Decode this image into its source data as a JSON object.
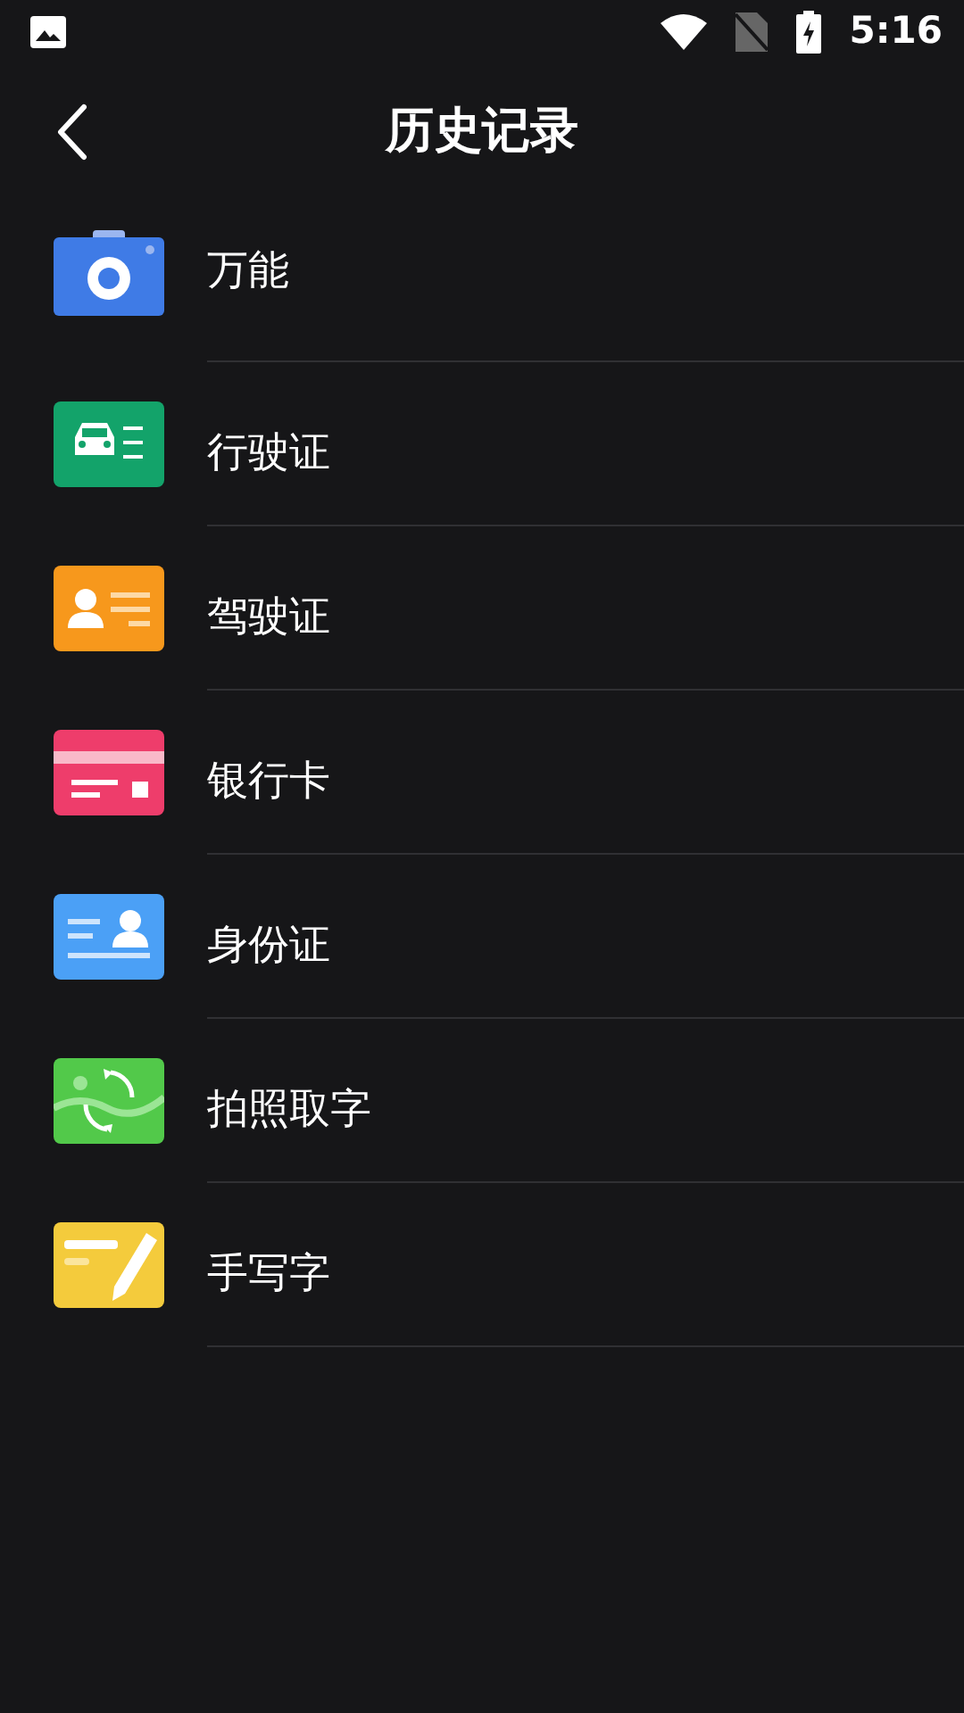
{
  "status_bar": {
    "time": "5:16"
  },
  "header": {
    "title": "历史记录"
  },
  "items": [
    {
      "kind": "camera",
      "label": "万能"
    },
    {
      "kind": "vehicle",
      "label": "行驶证"
    },
    {
      "kind": "driver",
      "label": "驾驶证"
    },
    {
      "kind": "bankcard",
      "label": "银行卡"
    },
    {
      "kind": "idcard",
      "label": "身份证"
    },
    {
      "kind": "phototext",
      "label": "拍照取字"
    },
    {
      "kind": "handwriting",
      "label": "手写字"
    }
  ]
}
